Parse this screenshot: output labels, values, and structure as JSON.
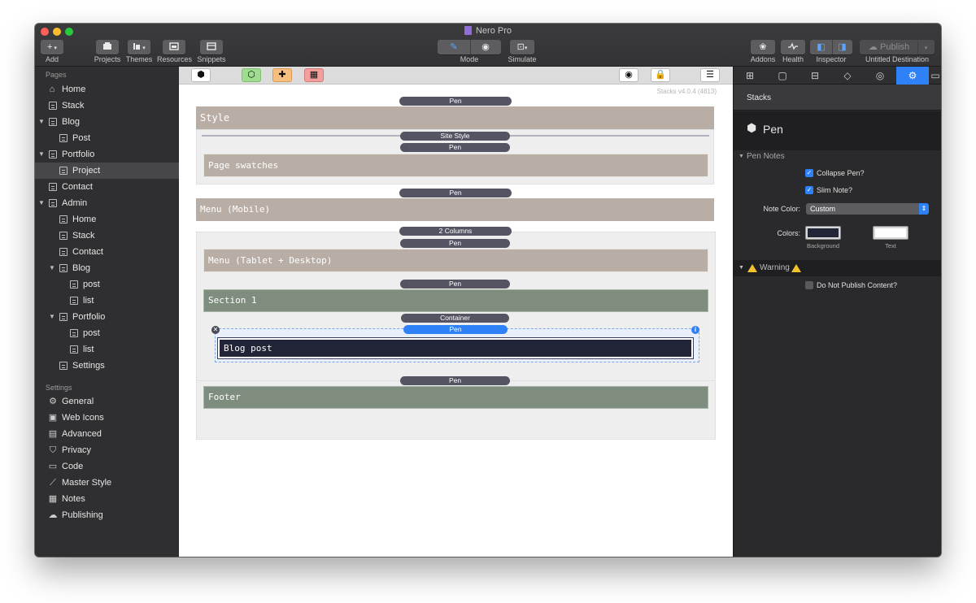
{
  "window": {
    "title": "Nero Pro"
  },
  "toolbar": {
    "add": {
      "icon": "plus-icon",
      "label": "Add"
    },
    "projects": {
      "label": "Projects"
    },
    "themes": {
      "label": "Themes"
    },
    "resources": {
      "label": "Resources"
    },
    "snippets": {
      "label": "Snippets"
    },
    "mode": {
      "label": "Mode",
      "options": [
        "pencil-icon",
        "eye-icon"
      ],
      "selected": "pencil-icon"
    },
    "simulate": {
      "label": "Simulate"
    },
    "addons": {
      "label": "Addons"
    },
    "health": {
      "label": "Health"
    },
    "inspector": {
      "label": "Inspector"
    },
    "publish": {
      "button_label": "Publish",
      "label": "Untitled Destination"
    }
  },
  "sidebar": {
    "pages_heading": "Pages",
    "pages": [
      {
        "label": "Home",
        "icon": "home-icon"
      },
      {
        "label": "Stack",
        "icon": "page-icon"
      },
      {
        "label": "Blog",
        "icon": "page-icon",
        "expanded": true
      },
      {
        "label": "Post",
        "icon": "page-icon"
      },
      {
        "label": "Portfolio",
        "icon": "page-icon",
        "expanded": true
      },
      {
        "label": "Project",
        "icon": "page-icon",
        "selected": true
      },
      {
        "label": "Contact",
        "icon": "page-icon"
      },
      {
        "label": "Admin",
        "icon": "page-icon",
        "expanded": true
      },
      {
        "label": "Home",
        "icon": "page-icon"
      },
      {
        "label": "Stack",
        "icon": "page-icon"
      },
      {
        "label": "Contact",
        "icon": "page-icon"
      },
      {
        "label": "Blog",
        "icon": "page-icon",
        "expanded": true
      },
      {
        "label": "post",
        "icon": "page-icon"
      },
      {
        "label": "list",
        "icon": "page-icon"
      },
      {
        "label": "Portfolio",
        "icon": "page-icon",
        "expanded": true
      },
      {
        "label": "post",
        "icon": "page-icon"
      },
      {
        "label": "list",
        "icon": "page-icon"
      },
      {
        "label": "Settings",
        "icon": "page-icon"
      }
    ],
    "settings_heading": "Settings",
    "settings": [
      {
        "label": "General",
        "icon": "gear-icon"
      },
      {
        "label": "Web Icons",
        "icon": "image-icon"
      },
      {
        "label": "Advanced",
        "icon": "code-icon"
      },
      {
        "label": "Privacy",
        "icon": "shield-icon"
      },
      {
        "label": "Code",
        "icon": "code-icon"
      },
      {
        "label": "Master Style",
        "icon": "magic-wand-icon"
      },
      {
        "label": "Notes",
        "icon": "notes-icon"
      },
      {
        "label": "Publishing",
        "icon": "cloud-icon"
      }
    ]
  },
  "canvas": {
    "version": "Stacks v4.0.4 (4813)",
    "pen": "Pen",
    "site_style": "Site Style",
    "two_columns": "2 Columns",
    "container": "Container",
    "blocks": {
      "style": "Style",
      "page_swatches": "Page swatches",
      "menu_mobile": "Menu (Mobile)",
      "menu_tablet": "Menu (Tablet + Desktop)",
      "section1": "Section 1",
      "blog_post": "Blog post",
      "footer": "Footer"
    }
  },
  "inspector": {
    "tabs": [
      "page-layout-icon",
      "page-icon",
      "layout-icon",
      "tag-icon",
      "target-icon",
      "stacks-gear-icon"
    ],
    "active_tab": 5,
    "section_title": "Stacks",
    "stack_name": "Pen",
    "pen_notes_heading": "Pen Notes",
    "collapse_pen": "Collapse Pen?",
    "collapse_pen_checked": true,
    "slim_note": "Slim Note?",
    "slim_note_checked": true,
    "note_color_label": "Note Color:",
    "note_color_value": "Custom",
    "colors_label": "Colors:",
    "background_label": "Background",
    "background_color": "#222437",
    "text_label": "Text",
    "text_color": "#ffffff",
    "warning_heading": "Warning",
    "do_not_publish": "Do Not Publish Content?",
    "do_not_publish_checked": false
  }
}
